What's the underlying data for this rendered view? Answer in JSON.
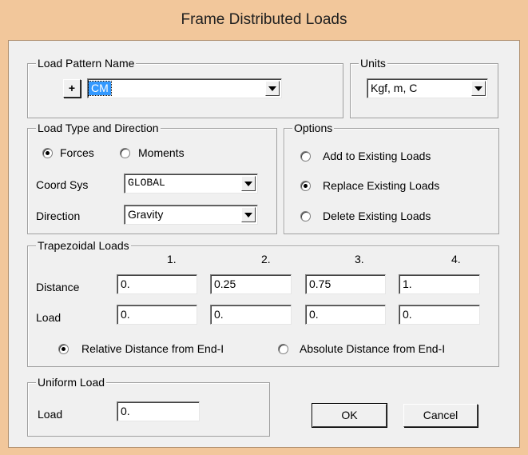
{
  "window": {
    "title": "Frame Distributed Loads"
  },
  "load_pattern": {
    "group_label": "Load Pattern Name",
    "add_label": "+",
    "selected": "CM"
  },
  "units": {
    "group_label": "Units",
    "selected": "Kgf, m, C"
  },
  "load_type": {
    "group_label": "Load Type and Direction",
    "forces_label": "Forces",
    "moments_label": "Moments",
    "selected_type": "Forces",
    "coord_sys_label": "Coord Sys",
    "coord_sys_value": "GLOBAL",
    "direction_label": "Direction",
    "direction_value": "Gravity"
  },
  "options": {
    "group_label": "Options",
    "add_label": "Add to Existing Loads",
    "replace_label": "Replace Existing Loads",
    "delete_label": "Delete Existing Loads",
    "selected": "Replace Existing Loads"
  },
  "trapezoidal": {
    "group_label": "Trapezoidal Loads",
    "columns": [
      "1.",
      "2.",
      "3.",
      "4."
    ],
    "distance_label": "Distance",
    "distances": [
      "0.",
      "0.25",
      "0.75",
      "1."
    ],
    "load_label": "Load",
    "loads": [
      "0.",
      "0.",
      "0.",
      "0."
    ],
    "relative_label": "Relative Distance from End-I",
    "absolute_label": "Absolute Distance from End-I",
    "selected_mode": "Relative Distance from End-I"
  },
  "uniform": {
    "group_label": "Uniform Load",
    "load_label": "Load",
    "load_value": "0."
  },
  "buttons": {
    "ok": "OK",
    "cancel": "Cancel"
  }
}
